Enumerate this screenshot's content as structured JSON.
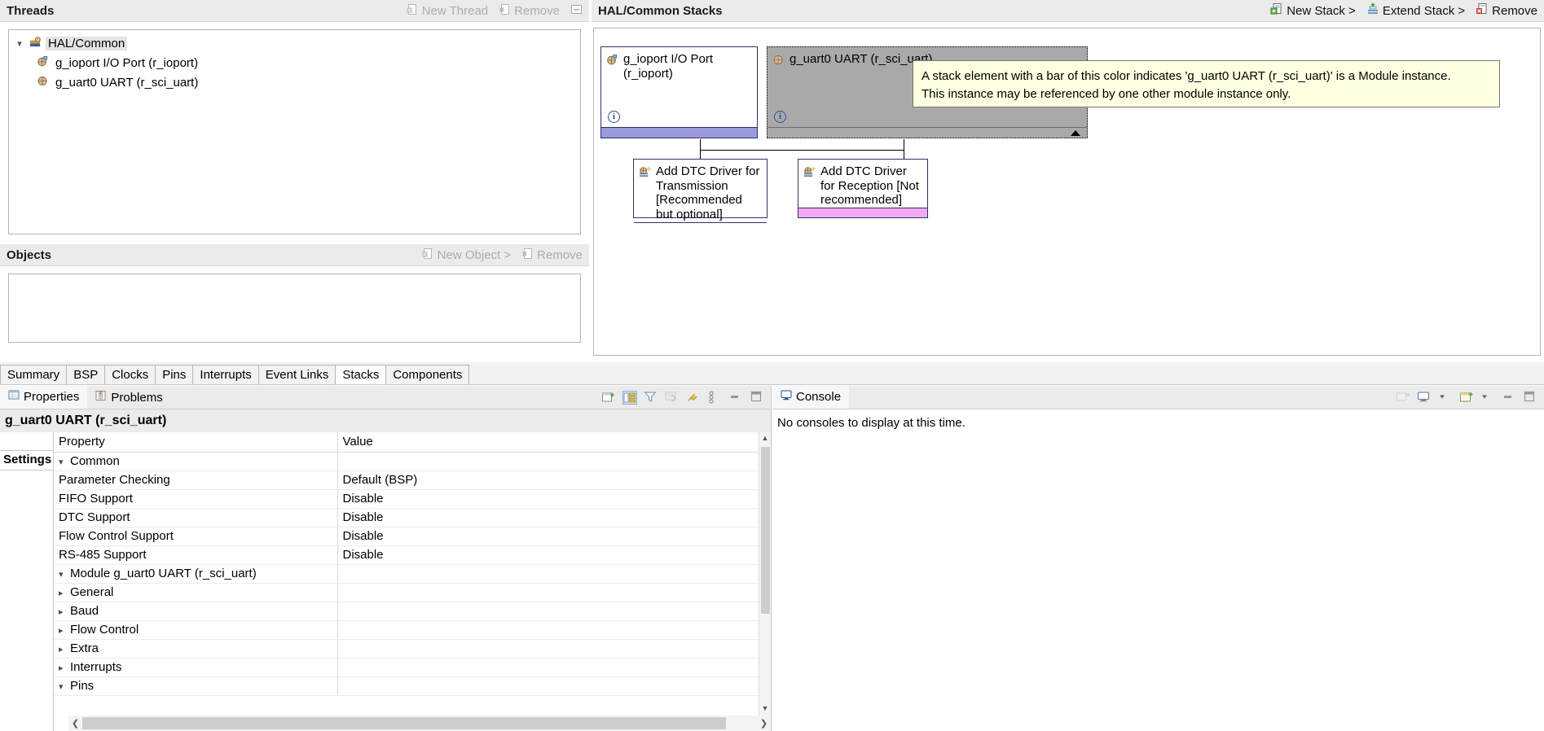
{
  "threads": {
    "title": "Threads",
    "actions": [
      {
        "label": "New Thread",
        "icon": "new-thread-icon",
        "enabled": false
      },
      {
        "label": "Remove",
        "icon": "remove-icon",
        "enabled": false
      },
      {
        "label": "",
        "icon": "collapse-all-icon",
        "enabled": false
      }
    ],
    "tree": [
      {
        "label": "HAL/Common",
        "icon": "hal-common-icon",
        "level": 0,
        "expanded": true,
        "selected": true
      },
      {
        "label": "g_ioport I/O Port (r_ioport)",
        "icon": "module-icon",
        "level": 1,
        "selected": false
      },
      {
        "label": "g_uart0 UART (r_sci_uart)",
        "icon": "module-icon",
        "level": 1,
        "selected": false
      }
    ]
  },
  "objects": {
    "title": "Objects",
    "actions": [
      {
        "label": "New Object >",
        "icon": "new-object-icon",
        "enabled": false
      },
      {
        "label": "Remove",
        "icon": "remove-icon",
        "enabled": false
      }
    ],
    "items": []
  },
  "stacks": {
    "title": "HAL/Common Stacks",
    "actions": [
      {
        "label": "New Stack >",
        "icon": "new-stack-icon",
        "enabled": true
      },
      {
        "label": "Extend Stack >",
        "icon": "extend-stack-icon",
        "enabled": true
      },
      {
        "label": "Remove",
        "icon": "remove-icon",
        "enabled": true
      }
    ],
    "boxes": [
      {
        "id": "ioport",
        "title": "g_ioport I/O Port (r_ioport)",
        "icon": "module-icon",
        "bar_color": "#9a9ae0",
        "selected": false,
        "info": "i"
      },
      {
        "id": "uart0",
        "title": "g_uart0 UART (r_sci_uart)",
        "icon": "module-icon",
        "bar_color": "#a9a9a9",
        "selected": true,
        "info": "i"
      },
      {
        "id": "dtc-tx",
        "title": "Add DTC Driver for Transmission [Recommended but optional]",
        "icon": "add-dtc-icon",
        "bar_color": "#f2aaf2",
        "selected": false,
        "info": ""
      },
      {
        "id": "dtc-rx",
        "title": "Add DTC Driver for Reception [Not recommended]",
        "icon": "add-dtc-icon",
        "bar_color": "#f2aaf2",
        "selected": false,
        "info": ""
      }
    ],
    "tooltip": {
      "line1": "A stack element with a bar of this color indicates 'g_uart0 UART (r_sci_uart)' is a Module instance.",
      "line2": "This instance may be referenced by one other module instance only."
    }
  },
  "configurator_tabs": {
    "items": [
      {
        "label": "Summary",
        "active": false
      },
      {
        "label": "BSP",
        "active": false
      },
      {
        "label": "Clocks",
        "active": false
      },
      {
        "label": "Pins",
        "active": false
      },
      {
        "label": "Interrupts",
        "active": false
      },
      {
        "label": "Event Links",
        "active": false
      },
      {
        "label": "Stacks",
        "active": true
      },
      {
        "label": "Components",
        "active": false
      }
    ]
  },
  "properties_view": {
    "tabs": [
      {
        "label": "Properties",
        "icon": "properties-icon",
        "active": true
      },
      {
        "label": "Problems",
        "icon": "problems-icon",
        "active": false
      }
    ],
    "toolbar": [
      {
        "icon": "new-properties-view-icon",
        "enabled": true,
        "selected": false
      },
      {
        "icon": "show-categories-icon",
        "enabled": true,
        "selected": true
      },
      {
        "icon": "filter-icon",
        "enabled": true,
        "selected": false
      },
      {
        "icon": "restore-defaults-icon",
        "enabled": false,
        "selected": false
      },
      {
        "icon": "pin-to-selection-icon",
        "enabled": true,
        "selected": false
      },
      {
        "icon": "view-menu-icon",
        "enabled": true,
        "selected": false
      },
      {
        "icon": "minimize-icon",
        "enabled": true,
        "selected": false
      },
      {
        "icon": "maximize-icon",
        "enabled": true,
        "selected": false
      }
    ],
    "title": "g_uart0 UART (r_sci_uart)",
    "side_tab": "Settings",
    "columns": [
      "Property",
      "Value"
    ],
    "rows": [
      {
        "label": "Common",
        "value": "",
        "indent": 0,
        "twisty": "expanded"
      },
      {
        "label": "Parameter Checking",
        "value": "Default (BSP)",
        "indent": 1,
        "twisty": "none"
      },
      {
        "label": "FIFO Support",
        "value": "Disable",
        "indent": 1,
        "twisty": "none"
      },
      {
        "label": "DTC Support",
        "value": "Disable",
        "indent": 1,
        "twisty": "none"
      },
      {
        "label": "Flow Control Support",
        "value": "Disable",
        "indent": 1,
        "twisty": "none"
      },
      {
        "label": "RS-485 Support",
        "value": "Disable",
        "indent": 1,
        "twisty": "none"
      },
      {
        "label": "Module g_uart0 UART (r_sci_uart)",
        "value": "",
        "indent": 0,
        "twisty": "expanded"
      },
      {
        "label": "General",
        "value": "",
        "indent": 2,
        "twisty": "collapsed"
      },
      {
        "label": "Baud",
        "value": "",
        "indent": 2,
        "twisty": "collapsed"
      },
      {
        "label": "Flow Control",
        "value": "",
        "indent": 2,
        "twisty": "collapsed"
      },
      {
        "label": "Extra",
        "value": "",
        "indent": 2,
        "twisty": "collapsed"
      },
      {
        "label": "Interrupts",
        "value": "",
        "indent": 2,
        "twisty": "collapsed"
      },
      {
        "label": "Pins",
        "value": "",
        "indent": 0,
        "twisty": "expanded"
      }
    ]
  },
  "console_view": {
    "tabs": [
      {
        "label": "Console",
        "icon": "console-icon",
        "active": true
      }
    ],
    "toolbar": [
      {
        "icon": "new-console-view-icon",
        "enabled": false
      },
      {
        "icon": "display-selected-console-icon",
        "enabled": true
      },
      {
        "icon": "display-selected-console-dropdown-icon",
        "enabled": true
      },
      {
        "icon": "open-console-icon",
        "enabled": true
      },
      {
        "icon": "open-console-dropdown-icon",
        "enabled": true
      },
      {
        "icon": "minimize-icon",
        "enabled": true
      },
      {
        "icon": "maximize-icon",
        "enabled": true
      }
    ],
    "message": "No consoles to display at this time."
  },
  "colors": {
    "panel_header_bg": "#ebebeb",
    "module_bar": "#9a9ae0",
    "selected_bar": "#a9a9a9",
    "optional_bar": "#f2aaf2",
    "tooltip_bg": "#ffffe1"
  }
}
